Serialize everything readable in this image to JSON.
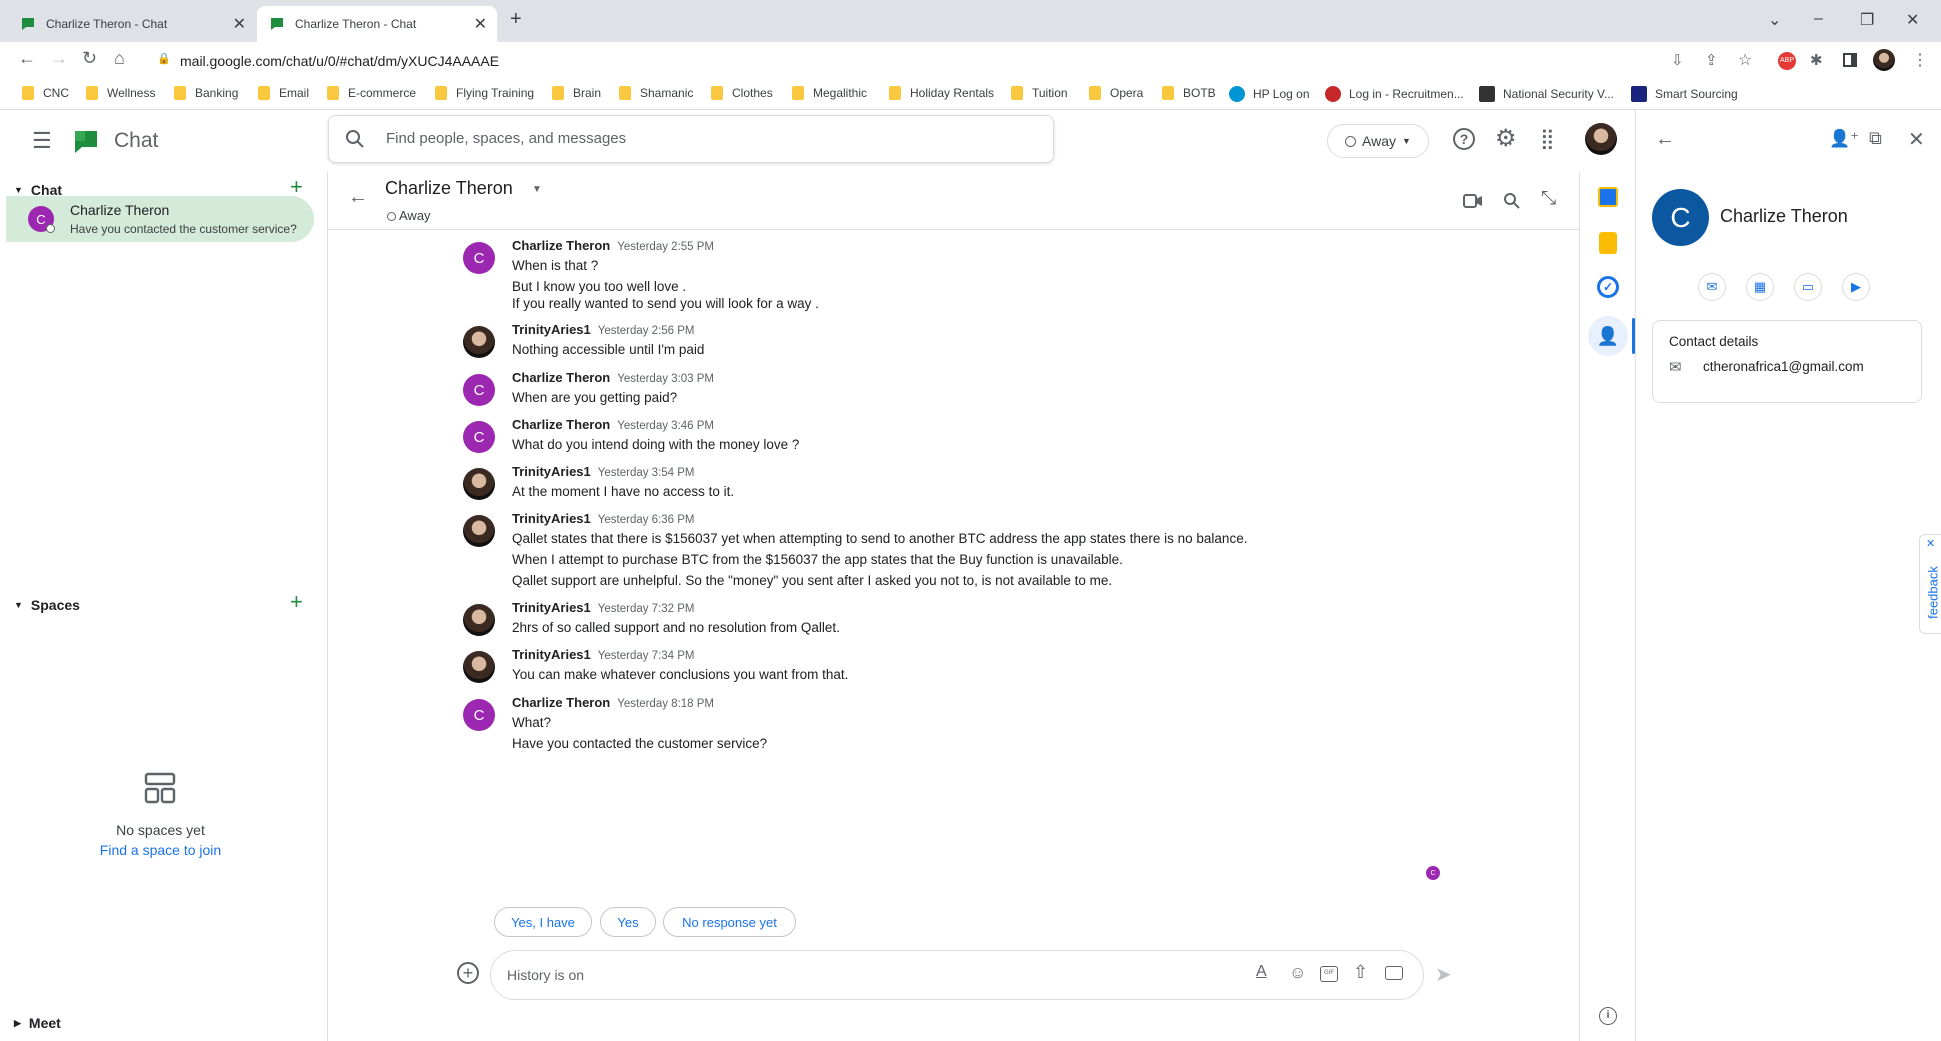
{
  "browser": {
    "tabs": [
      {
        "title": "Charlize Theron - Chat"
      },
      {
        "title": "Charlize Theron - Chat"
      }
    ],
    "url": "mail.google.com/chat/u/0/#chat/dm/yXUCJ4AAAAE",
    "bookmarks": [
      "CNC",
      "Wellness",
      "Banking",
      "Email",
      "E-commerce",
      "Flying Training",
      "Brain",
      "Shamanic",
      "Clothes",
      "Megalithic",
      "Holiday Rentals",
      "Tuition",
      "Opera",
      "BOTB",
      "HP Log on",
      "Log in - Recruitmen...",
      "National Security V...",
      "Smart Sourcing"
    ]
  },
  "app": {
    "title": "Chat",
    "search_placeholder": "Find people, spaces, and messages",
    "status": "Away"
  },
  "sidebar": {
    "chat_section": "Chat",
    "chat_item": {
      "initial": "C",
      "name": "Charlize Theron",
      "preview": "Have you contacted the customer service?"
    },
    "spaces_section": "Spaces",
    "no_spaces": "No spaces yet",
    "find_space": "Find a space to join",
    "meet_section": "Meet"
  },
  "conversation": {
    "name": "Charlize Theron",
    "status": "Away",
    "messages": [
      {
        "sender": "Charlize Theron",
        "time": "Yesterday 2:55 PM",
        "avatar": "C",
        "lines": [
          "When is that ?",
          "But I know you too well love .",
          "If you really wanted to send you will look for a way ."
        ]
      },
      {
        "sender": "TrinityAries1",
        "time": "Yesterday 2:56 PM",
        "avatar": "photo",
        "lines": [
          "Nothing accessible until I'm paid"
        ]
      },
      {
        "sender": "Charlize Theron",
        "time": "Yesterday 3:03 PM",
        "avatar": "C",
        "lines": [
          "When are you getting paid?"
        ]
      },
      {
        "sender": "Charlize Theron",
        "time": "Yesterday 3:46 PM",
        "avatar": "C",
        "lines": [
          "What do you intend doing with the money love ?"
        ]
      },
      {
        "sender": "TrinityAries1",
        "time": "Yesterday 3:54 PM",
        "avatar": "photo",
        "lines": [
          "At the moment I have no access to it."
        ]
      },
      {
        "sender": "TrinityAries1",
        "time": "Yesterday 6:36 PM",
        "avatar": "photo",
        "lines": [
          "Qallet states that there is $156037 yet when attempting to send to another BTC address the app states there is no balance.",
          "When I attempt to purchase BTC from the $156037 the app states that the Buy function is unavailable.",
          "Qallet support are unhelpful. So the \"money\" you sent after I asked you not to, is not available to me."
        ]
      },
      {
        "sender": "TrinityAries1",
        "time": "Yesterday 7:32 PM",
        "avatar": "photo",
        "lines": [
          "2hrs of so called support and no resolution from Qallet."
        ]
      },
      {
        "sender": "TrinityAries1",
        "time": "Yesterday 7:34 PM",
        "avatar": "photo",
        "lines": [
          "You can make whatever conclusions you want from that."
        ]
      },
      {
        "sender": "Charlize Theron",
        "time": "Yesterday 8:18 PM",
        "avatar": "C",
        "lines": [
          "What?",
          "Have you contacted the customer service?"
        ]
      }
    ],
    "read_receipt": "C",
    "smart_replies": [
      "Yes, I have",
      "Yes",
      "No response yet"
    ],
    "composer_placeholder": "History is on"
  },
  "side_panel": {
    "initial": "C",
    "name": "Charlize Theron",
    "contact_title": "Contact details",
    "email": "ctheronafrica1@gmail.com",
    "feedback": "feedback"
  },
  "colors": {
    "chat_green": "#1e8e3e",
    "selected_bg": "#d3ebd8",
    "avatar_purple": "#9c27b0",
    "panel_avatar_blue": "#0b57a0",
    "link_blue": "#1a73e8"
  }
}
